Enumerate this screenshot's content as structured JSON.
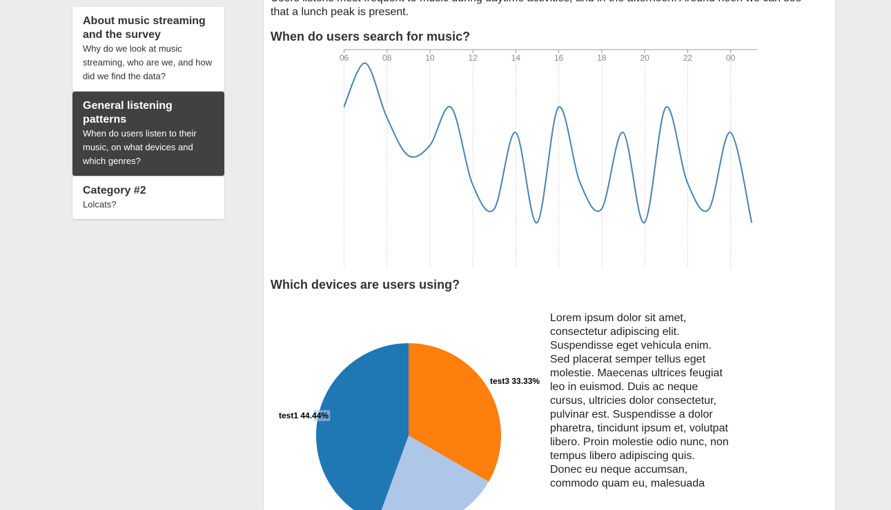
{
  "sidebar": {
    "items": [
      {
        "title": "About music streaming and the survey",
        "description": "Why do we look at music streaming, who are we, and how did we find the data?",
        "active": false
      },
      {
        "title": "General listening patterns",
        "description": "When do users listen to their music, on what devices and which genres?",
        "active": true
      },
      {
        "title": "Category #2",
        "description": "Lolcats?",
        "active": false
      }
    ]
  },
  "main": {
    "intro_text": "Users listens most frequent to music during daytime activities, and in the afternoon. Around noon we can see that a lunch peak is present.",
    "search_heading": "When do users search for music?",
    "devices_heading": "Which devices are users using?",
    "lorem": "Lorem ipsum dolor sit amet, consectetur adipiscing elit. Suspendisse eget vehicula enim. Sed placerat semper tellus eget molestie. Maecenas ultrices feugiat leo in euismod. Duis ac neque cursus, ultricies dolor consectetur, pulvinar est. Suspendisse a dolor pharetra, tincidunt ipsum et, volutpat libero. Proin molestie odio nunc, non tempus libero adipiscing quis. Donec eu neque accumsan, commodo quam eu, malesuada"
  },
  "chart_data": [
    {
      "type": "line",
      "title": "When do users search for music?",
      "xlabel": "",
      "ylabel": "",
      "x_ticks": [
        "06",
        "08",
        "10",
        "12",
        "14",
        "16",
        "18",
        "20",
        "22",
        "00"
      ],
      "x": [
        6,
        7,
        8,
        9,
        10,
        11,
        12,
        13,
        14,
        15,
        16,
        17,
        18,
        19,
        20,
        21,
        22,
        23,
        24,
        25
      ],
      "series": [
        {
          "color": "#4682b4",
          "values": [
            0.75,
            0.98,
            0.7,
            0.5,
            0.55,
            0.75,
            0.35,
            0.22,
            0.62,
            0.15,
            0.75,
            0.36,
            0.22,
            0.62,
            0.15,
            0.75,
            0.36,
            0.22,
            0.62,
            0.15
          ]
        }
      ],
      "ylim": [
        0,
        1
      ],
      "grid": true,
      "line_color": "#4682b4"
    },
    {
      "type": "pie",
      "title": "Which devices are users using?",
      "slices": [
        {
          "label": "test3",
          "value": 33.33,
          "text": "test3 33.33%",
          "color": "#ff7f0e"
        },
        {
          "label": "test2",
          "value": 22.22,
          "text": "",
          "color": "#aec7e8"
        },
        {
          "label": "test1",
          "value": 44.44,
          "text": "test1 44.44%",
          "color": "#1f77b4"
        }
      ]
    }
  ]
}
